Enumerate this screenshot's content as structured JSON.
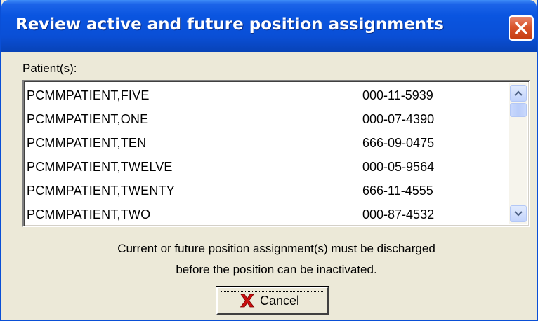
{
  "window": {
    "title": "Review active and future position assignments",
    "close_icon": "close-icon"
  },
  "patients": {
    "label": "Patient(s):",
    "rows": [
      {
        "name": "PCMMPATIENT,FIVE",
        "ssn": "000-11-5939"
      },
      {
        "name": "PCMMPATIENT,ONE",
        "ssn": "000-07-4390"
      },
      {
        "name": "PCMMPATIENT,TEN",
        "ssn": "666-09-0475"
      },
      {
        "name": "PCMMPATIENT,TWELVE",
        "ssn": "000-05-9564"
      },
      {
        "name": "PCMMPATIENT,TWENTY",
        "ssn": "666-11-4555"
      },
      {
        "name": "PCMMPATIENT,TWO",
        "ssn": "000-87-4532"
      }
    ]
  },
  "message": {
    "line1": "Current or future position assignment(s) must be discharged",
    "line2": "before the position can be inactivated."
  },
  "cancel": {
    "label": "Cancel",
    "icon": "red-x-icon"
  },
  "colors": {
    "titlebar": "#0a4fd6",
    "close_button": "#d9532a",
    "dialog_background": "#ece9d8",
    "cancel_icon": "#cc1010"
  }
}
